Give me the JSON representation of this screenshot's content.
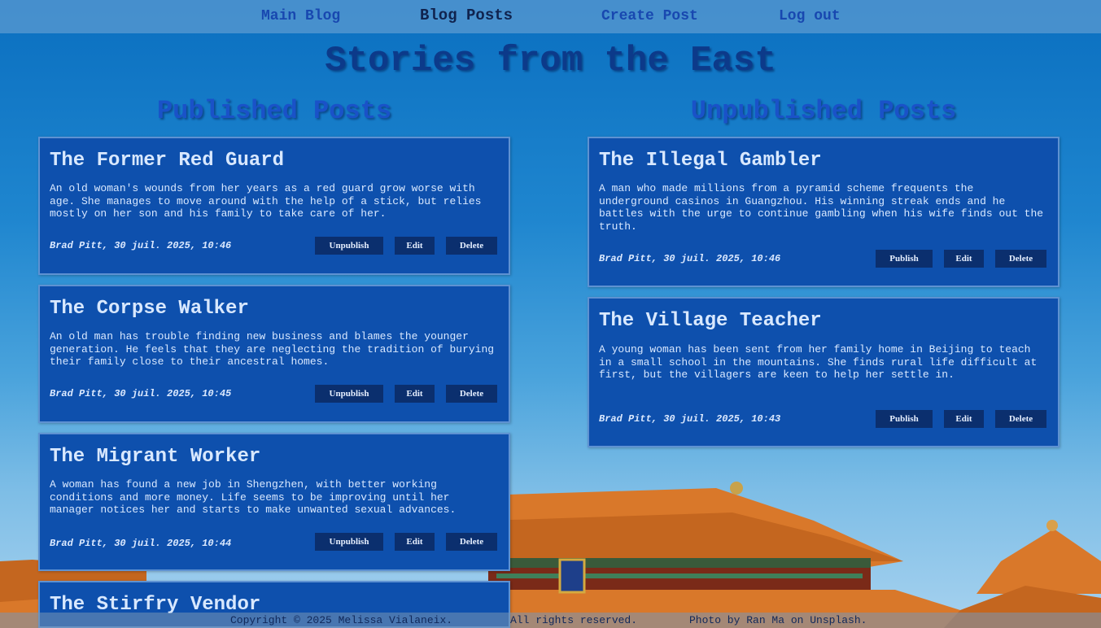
{
  "nav": {
    "main_blog": "Main Blog",
    "blog_posts": "Blog Posts",
    "create_post": "Create Post",
    "log_out": "Log out"
  },
  "page_title": "Stories from the East",
  "published": {
    "heading": "Published Posts",
    "posts": [
      {
        "title": "The Former Red Guard",
        "body": "An old woman's wounds from her years as a red guard grow worse with age. She manages to move around with the help of a stick, but relies mostly on her son and his family to take care of her.",
        "meta": "Brad Pitt, 30 juil. 2025, 10:46",
        "action": "Unpublish",
        "edit": "Edit",
        "delete": "Delete"
      },
      {
        "title": "The Corpse Walker",
        "body": "An old man has trouble finding new business and blames the younger generation. He feels that they are neglecting the tradition of burying their family close to their ancestral homes.",
        "meta": "Brad Pitt, 30 juil. 2025, 10:45",
        "action": "Unpublish",
        "edit": "Edit",
        "delete": "Delete"
      },
      {
        "title": "The Migrant Worker",
        "body": "A woman has found a new job in Shengzhen, with better working conditions and more money. Life seems to be improving until her manager notices her and starts to make unwanted sexual advances.",
        "meta": "Brad Pitt, 30 juil. 2025, 10:44",
        "action": "Unpublish",
        "edit": "Edit",
        "delete": "Delete"
      },
      {
        "title": "The Stirfry Vendor"
      }
    ]
  },
  "unpublished": {
    "heading": "Unpublished Posts",
    "posts": [
      {
        "title": "The Illegal Gambler",
        "body": "A man who made millions from a pyramid scheme frequents the underground casinos in Guangzhou. His winning streak ends and he battles with the urge to continue gambling when his wife finds out the truth.",
        "meta": "Brad Pitt, 30 juil. 2025, 10:46",
        "action": "Publish",
        "edit": "Edit",
        "delete": "Delete"
      },
      {
        "title": "The Village Teacher",
        "body": "A young woman has been sent from her family home in Beijing to teach in a small school in the mountains. She finds rural life difficult at first, but the villagers are keen to help her settle in.",
        "meta": "Brad Pitt, 30 juil. 2025, 10:43",
        "action": "Publish",
        "edit": "Edit",
        "delete": "Delete"
      }
    ]
  },
  "footer": {
    "copyright": "Copyright © 2025 Melissa Vialaneix.",
    "rights": "All rights reserved.",
    "photo_credit": "Photo by Ran Ma on Unsplash."
  }
}
